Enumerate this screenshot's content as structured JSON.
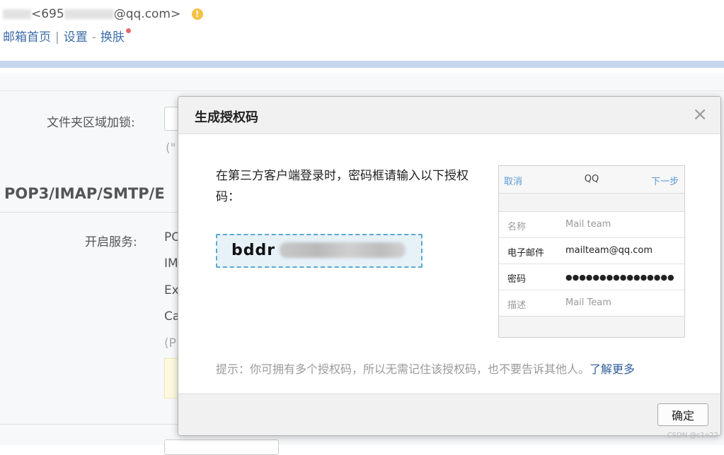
{
  "header": {
    "account_prefix": "<695",
    "account_suffix": "@qq.com>",
    "warn_icon": "!",
    "links": {
      "home": "邮箱首页",
      "sep": "|",
      "settings": "设置",
      "dash": "-",
      "skin": "换肤"
    }
  },
  "background": {
    "folder_lock_label": "文件夹区域加锁:",
    "folder_hint": "(\"",
    "section_title": "POP3/IMAP/SMTP/E",
    "services_label": "开启服务:",
    "service_items": [
      "PO",
      "IM",
      "Ex",
      "Ca",
      "(P"
    ]
  },
  "modal": {
    "title": "生成授权码",
    "close": "×",
    "instruction": "在第三方客户端登录时，密码框请输入以下授权码：",
    "auth_code_visible": "bddr",
    "tip_text": "提示：你可拥有多个授权码，所以无需记住该授权码，也不要告诉其他人。",
    "learn_more": "了解更多",
    "ok_button": "确定",
    "phone": {
      "cancel": "取消",
      "title": "QQ",
      "next": "下一步",
      "rows": [
        {
          "label": "名称",
          "value": "Mail team"
        },
        {
          "label": "电子邮件",
          "value": "mailteam@qq.com"
        },
        {
          "label": "密码",
          "value": "●●●●●●●●●●●●●●●●"
        },
        {
          "label": "描述",
          "value": "Mail Team"
        }
      ]
    }
  },
  "watermark": "CSDN @c1o22"
}
